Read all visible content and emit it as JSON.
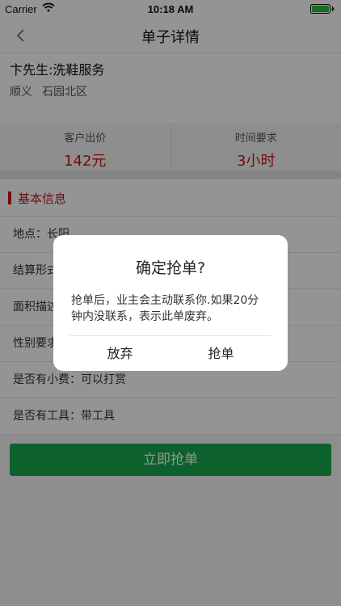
{
  "status_bar": {
    "carrier": "Carrier",
    "time": "10:18 AM"
  },
  "nav": {
    "title": "单子详情",
    "back_icon": "chevron-left-icon"
  },
  "order": {
    "customer": "卞先生:洗鞋服务",
    "district": "顺义",
    "community": "石园北区"
  },
  "stats": [
    {
      "label": "客户出价",
      "value": "142元"
    },
    {
      "label": "时间要求",
      "value": "3小时"
    }
  ],
  "section": {
    "title": "基本信息"
  },
  "rows": [
    {
      "text": "地点：长阳"
    },
    {
      "text": "结算形式"
    },
    {
      "text": "面积描述"
    },
    {
      "text": "性别要求"
    },
    {
      "text": "是否有小费：可以打赏"
    },
    {
      "text": "是否有工具：带工具"
    }
  ],
  "cta": {
    "label": "立即抢单"
  },
  "dialog": {
    "title": "确定抢单?",
    "message": "抢单后，业主会主动联系你.如果20分钟内没联系，表示此单废弃。",
    "cancel_label": "放弃",
    "confirm_label": "抢单"
  },
  "colors": {
    "accent_red": "#c8161d",
    "cta_green": "#17a84f"
  }
}
